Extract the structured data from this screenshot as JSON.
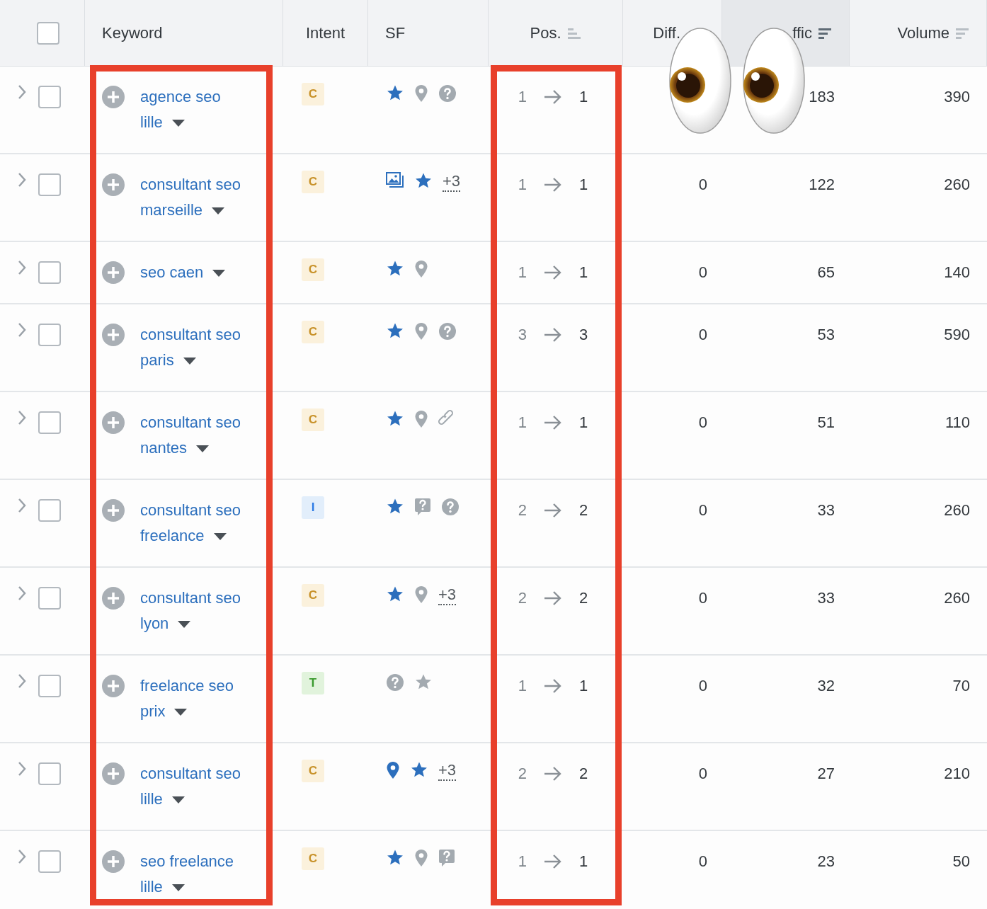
{
  "select_all": {
    "checked": false
  },
  "columns": [
    {
      "label": "Keyword",
      "sorted": false
    },
    {
      "label": "Intent",
      "sorted": false
    },
    {
      "label": "SF",
      "sorted": false
    },
    {
      "label": "Pos.",
      "ascending": true,
      "sorted": false
    },
    {
      "label": "Diff.",
      "sorted": false
    },
    {
      "label": "ffic",
      "ascending": false,
      "sorted": true
    },
    {
      "label": "Volume",
      "ascending": false,
      "sorted": false
    }
  ],
  "rows": [
    {
      "checked": false,
      "keyword": "agence seo lille",
      "intent": "C",
      "sf": [
        {
          "kind": "star",
          "active": true
        },
        {
          "kind": "pin",
          "active": false
        },
        {
          "kind": "question",
          "active": false
        }
      ],
      "pos_from": "1",
      "pos_to": "1",
      "traffic": "183",
      "volume": "390"
    },
    {
      "checked": false,
      "keyword": "consultant seo marseille",
      "intent": "C",
      "sf": [
        {
          "kind": "image",
          "active": true
        },
        {
          "kind": "star",
          "active": true
        },
        {
          "kind": "more",
          "text": "+3"
        }
      ],
      "pos_from": "1",
      "pos_to": "1",
      "diff": "0",
      "traffic": "122",
      "volume": "260"
    },
    {
      "checked": false,
      "keyword": "seo caen",
      "intent": "C",
      "sf": [
        {
          "kind": "star",
          "active": true
        },
        {
          "kind": "pin",
          "active": false
        }
      ],
      "pos_from": "1",
      "pos_to": "1",
      "diff": "0",
      "traffic": "65",
      "volume": "140"
    },
    {
      "checked": false,
      "keyword": "consultant seo paris",
      "intent": "C",
      "sf": [
        {
          "kind": "star",
          "active": true
        },
        {
          "kind": "pin",
          "active": false
        },
        {
          "kind": "question",
          "active": false
        }
      ],
      "pos_from": "3",
      "pos_to": "3",
      "diff": "0",
      "traffic": "53",
      "volume": "590"
    },
    {
      "checked": false,
      "keyword": "consultant seo nantes",
      "intent": "C",
      "sf": [
        {
          "kind": "star",
          "active": true
        },
        {
          "kind": "pin",
          "active": false
        },
        {
          "kind": "link",
          "active": false
        }
      ],
      "pos_from": "1",
      "pos_to": "1",
      "diff": "0",
      "traffic": "51",
      "volume": "110"
    },
    {
      "checked": false,
      "keyword": "consultant seo freelance",
      "intent": "I",
      "sf": [
        {
          "kind": "star",
          "active": true
        },
        {
          "kind": "bubble",
          "active": false
        },
        {
          "kind": "question",
          "active": false
        }
      ],
      "pos_from": "2",
      "pos_to": "2",
      "diff": "0",
      "traffic": "33",
      "volume": "260"
    },
    {
      "checked": false,
      "keyword": "consultant seo lyon",
      "intent": "C",
      "sf": [
        {
          "kind": "star",
          "active": true
        },
        {
          "kind": "pin",
          "active": false
        },
        {
          "kind": "more",
          "text": "+3"
        }
      ],
      "pos_from": "2",
      "pos_to": "2",
      "diff": "0",
      "traffic": "33",
      "volume": "260"
    },
    {
      "checked": false,
      "keyword": "freelance seo prix",
      "intent": "T",
      "sf": [
        {
          "kind": "question",
          "active": false
        },
        {
          "kind": "star",
          "active": false
        }
      ],
      "pos_from": "1",
      "pos_to": "1",
      "diff": "0",
      "traffic": "32",
      "volume": "70"
    },
    {
      "checked": false,
      "keyword": "consultant seo lille",
      "intent": "C",
      "sf": [
        {
          "kind": "pin",
          "active": true
        },
        {
          "kind": "star",
          "active": true
        },
        {
          "kind": "more",
          "text": "+3"
        }
      ],
      "pos_from": "2",
      "pos_to": "2",
      "diff": "0",
      "traffic": "27",
      "volume": "210"
    },
    {
      "checked": false,
      "keyword": "seo freelance lille",
      "intent": "C",
      "sf": [
        {
          "kind": "star",
          "active": true
        },
        {
          "kind": "pin",
          "active": false
        },
        {
          "kind": "bubble",
          "active": false
        }
      ],
      "pos_from": "1",
      "pos_to": "1",
      "diff": "0",
      "traffic": "23",
      "volume": "50"
    }
  ]
}
